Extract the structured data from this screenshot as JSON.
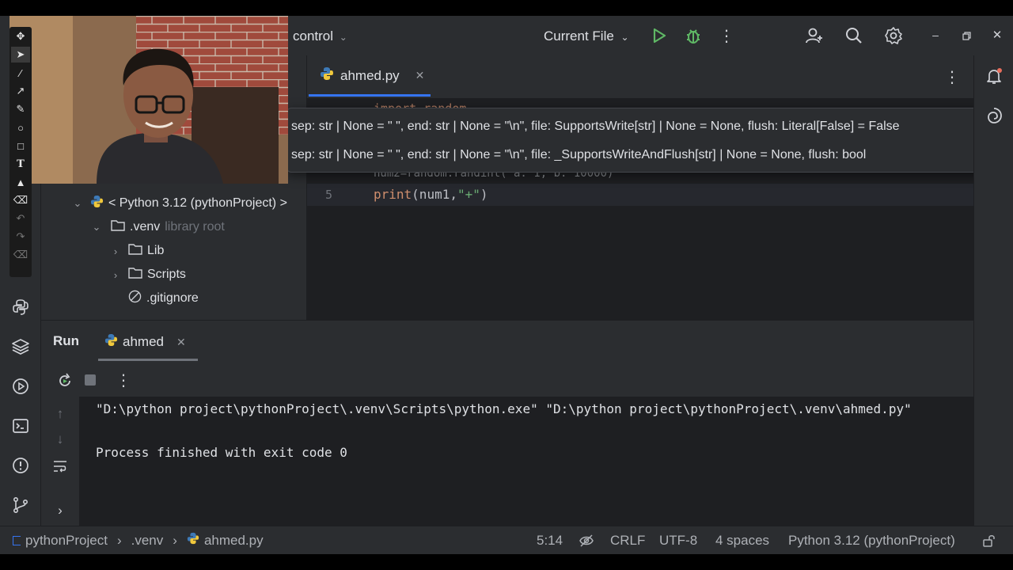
{
  "topbar": {
    "vcs_label": "control",
    "run_config": "Current File"
  },
  "editor": {
    "tab_label": "ahmed.py",
    "line5_number": "5",
    "line5_func": "print",
    "line5_args": "(num1,",
    "line5_string": "\"+\"",
    "line5_close": ")",
    "obscured_line1": "import random",
    "obscured_line4": "num2=random.randint( a: 1, b: 10000)"
  },
  "tooltip": {
    "sig1": "sep: str | None = \" \", end: str | None = \"\\n\", file: SupportsWrite[str] | None = None, flush: Literal[False] = False",
    "sig2": "sep: str | None = \" \", end: str | None = \"\\n\", file: _SupportsWriteAndFlush[str] | None = None, flush: bool"
  },
  "project_tree": {
    "sdk_row": "< Python 3.12 (pythonProject) >",
    "venv_label": ".venv",
    "venv_hint": "library root",
    "lib_label": "Lib",
    "scripts_label": "Scripts",
    "gitignore_label": ".gitignore"
  },
  "run_panel": {
    "title": "Run",
    "tab_label": "ahmed",
    "command_line": "\"D:\\python project\\pythonProject\\.venv\\Scripts\\python.exe\" \"D:\\python project\\pythonProject\\.venv\\ahmed.py\"",
    "exit_line": "Process finished with exit code 0"
  },
  "statusbar": {
    "crumb_project": "pythonProject",
    "crumb_venv": ".venv",
    "crumb_file": "ahmed.py",
    "position": "5:14",
    "line_ending": "CRLF",
    "encoding": "UTF-8",
    "indent": "4 spaces",
    "interpreter": "Python 3.12 (pythonProject)"
  },
  "colors": {
    "accent": "#3574f0",
    "run_green": "#5fb865",
    "keyword": "#cf8e6d",
    "string": "#6aab73"
  }
}
